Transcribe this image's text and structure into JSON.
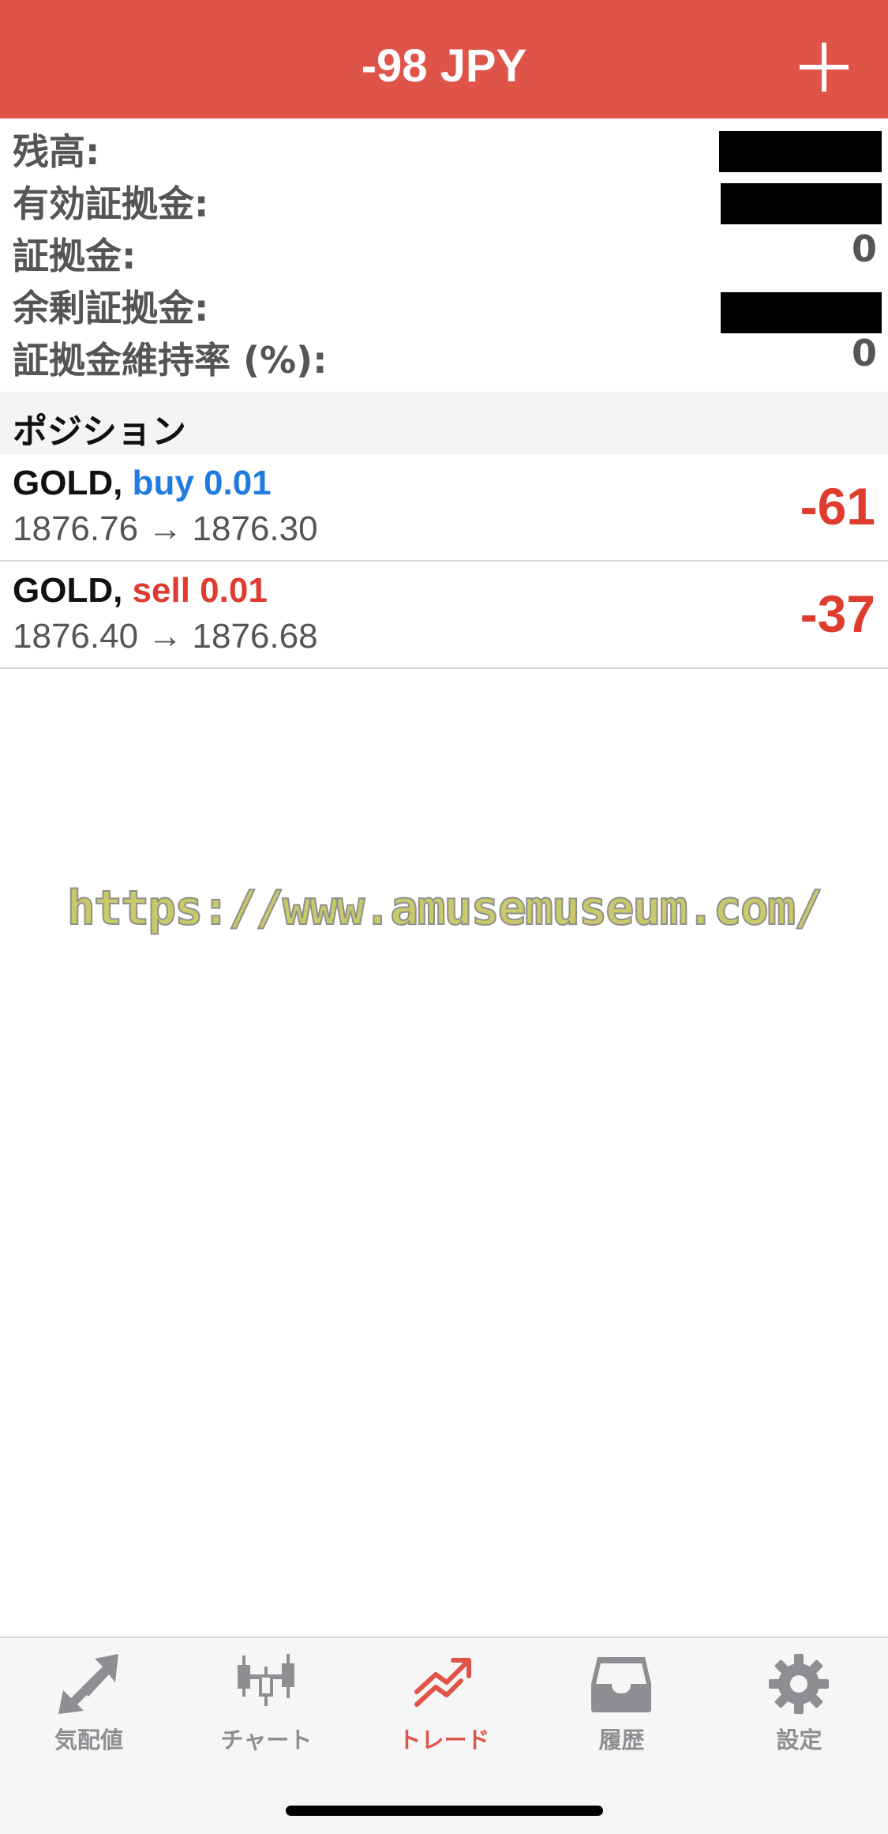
{
  "header": {
    "title": "-98 JPY",
    "add_icon": "plus-icon"
  },
  "summary": [
    {
      "label": "残高:",
      "value": "",
      "redacted": true
    },
    {
      "label": "有効証拠金:",
      "value": "",
      "redacted": true
    },
    {
      "label": "証拠金:",
      "value": "0",
      "redacted": false
    },
    {
      "label": "余剰証拠金:",
      "value": "",
      "redacted": true
    },
    {
      "label": "証拠金維持率 (%):",
      "value": "0",
      "redacted": false
    }
  ],
  "positions_section": {
    "title": "ポジション"
  },
  "positions": [
    {
      "symbol": "GOLD,",
      "type_volume": "buy 0.01",
      "side": "buy",
      "prices": "1876.76 → 1876.30",
      "profit": "-61"
    },
    {
      "symbol": "GOLD,",
      "type_volume": "sell 0.01",
      "side": "sell",
      "prices": "1876.40 → 1876.68",
      "profit": "-37"
    }
  ],
  "watermark": "https://www.amusemuseum.com/",
  "tabs": [
    {
      "label": "気配値",
      "icon": "quotes-arrows-icon",
      "active": false
    },
    {
      "label": "チャート",
      "icon": "candlestick-chart-icon",
      "active": false
    },
    {
      "label": "トレード",
      "icon": "trade-trend-icon",
      "active": true
    },
    {
      "label": "履歴",
      "icon": "history-inbox-icon",
      "active": false
    },
    {
      "label": "設定",
      "icon": "settings-gear-icon",
      "active": false
    }
  ],
  "colors": {
    "header": "#df5449",
    "buy": "#1f7be0",
    "sell": "#df3b2e",
    "tab_active": "#df5449",
    "tab_inactive": "#8e8e93"
  }
}
